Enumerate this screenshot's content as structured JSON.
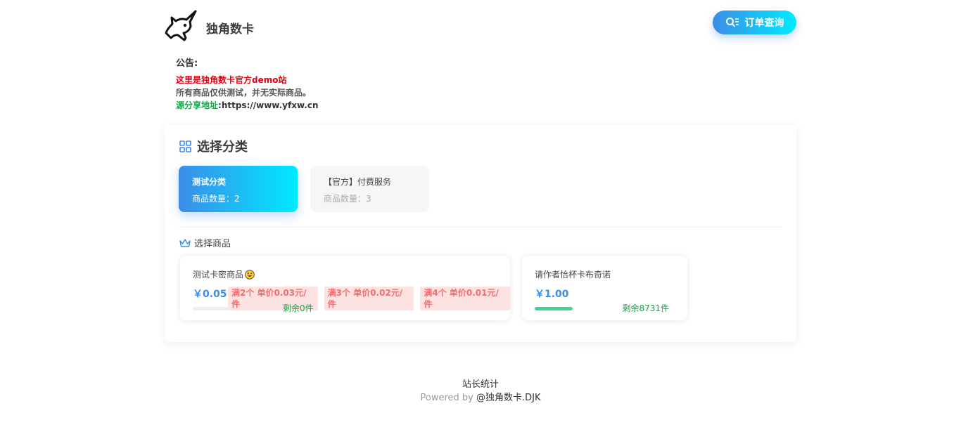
{
  "header": {
    "site_title": "独角数卡",
    "order_button": "订单查询"
  },
  "notice": {
    "title": "公告:",
    "line1": "这里是独角数卡官方demo站",
    "line2": "所有商品仅供测试，并无实际商品。",
    "line3_label": "源分享地址",
    "line3_url": ":https://www.yfxw.cn"
  },
  "categories": {
    "title": "选择分类",
    "items": [
      {
        "name": "测试分类",
        "count": "商品数量：2",
        "active": true
      },
      {
        "name": "【官方】付费服务",
        "count": "商品数量：3",
        "active": false
      }
    ]
  },
  "goods": {
    "title": "选择商品",
    "items": [
      {
        "name": "测试卡密商品",
        "price": "￥0.05",
        "tags": [
          "满2个 单价0.03元/件",
          "满3个 单价0.02元/件",
          "满4个 单价0.01元/件"
        ],
        "stock": "剩余0件",
        "stock_level": 0
      },
      {
        "name": "请作者恰杯卡布奇诺",
        "price": "￥1.00",
        "tags": [],
        "stock": "剩余8731件",
        "stock_level": 1
      }
    ]
  },
  "footer": {
    "stat": "站长统计",
    "powered": "Powered by ",
    "brand": "@独角数卡.DJK"
  },
  "colors": {
    "accent_start": "#3c8ce7",
    "accent_end": "#00eaff",
    "notice_red": "#e60012",
    "notice_green": "#1aa34a",
    "tag_bg": "#fde2e2",
    "tag_text": "#f56c6c",
    "stock_bar": "#3ed58f"
  },
  "icons": {
    "logo": "unicorn-icon",
    "order_button": "search-list-icon",
    "categories": "grid-icon",
    "goods": "crown-icon",
    "goods_emoji": "smiley-icon"
  }
}
